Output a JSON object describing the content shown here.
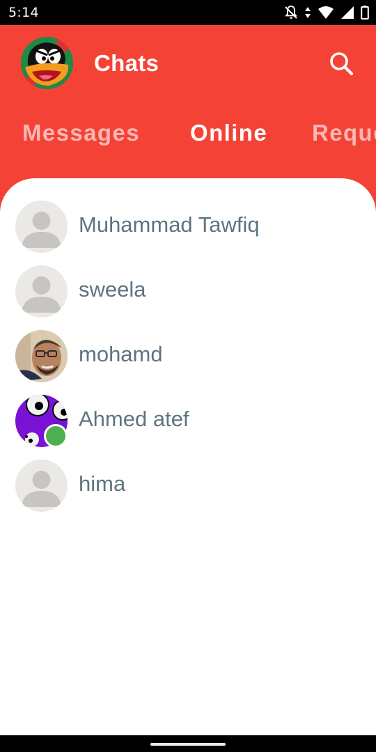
{
  "status_bar": {
    "time": "5:14",
    "icons": [
      "notifications-off-icon",
      "data-arrows-icon",
      "wifi-icon",
      "cell-signal-icon",
      "battery-icon"
    ]
  },
  "header": {
    "title": "Chats",
    "profile_icon": "duck-cartoon-avatar",
    "search_icon": "search-icon"
  },
  "tabs": [
    {
      "label": "Messages",
      "active": false
    },
    {
      "label": "Online",
      "active": true
    },
    {
      "label": "Requests",
      "active": false
    }
  ],
  "contacts": [
    {
      "name": "Muhammad Tawfiq",
      "avatar": "default-person-avatar",
      "online_indicator": false
    },
    {
      "name": "sweela",
      "avatar": "default-person-avatar",
      "online_indicator": false
    },
    {
      "name": "mohamd",
      "avatar": "photo-avatar",
      "online_indicator": false
    },
    {
      "name": "Ahmed atef",
      "avatar": "cartoon-eyes-avatar",
      "online_indicator": true
    },
    {
      "name": "hima",
      "avatar": "default-person-avatar",
      "online_indicator": false
    }
  ],
  "colors": {
    "primary": "#f44336",
    "name_text": "#5e7480",
    "online_dot": "#4caf50",
    "placeholder_avatar": "#ebe9e6"
  }
}
